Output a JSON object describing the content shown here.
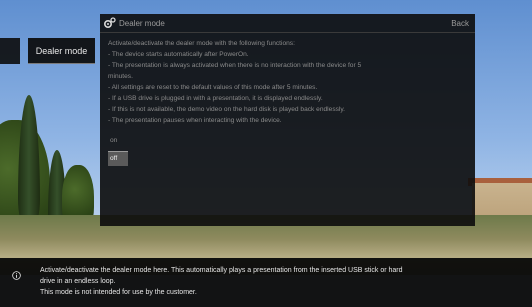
{
  "sidebar": {
    "selected_label": "Dealer mode"
  },
  "dialog": {
    "title": "Dealer mode",
    "back_label": "Back",
    "icon": "gear-icon",
    "description_lines": [
      "Activate/deactivate the dealer mode with the following functions:",
      "- The device starts automatically after PowerOn.",
      "- The presentation is always activated when there is no interaction with the device for 5",
      "minutes.",
      "- All settings are reset to the default values of this mode after 5 minutes.",
      "- If a USB drive is plugged in with a presentation, it is displayed endlessly.",
      "- If this is not available, the demo video on the hard disk is played back endlessly.",
      "- The presentation pauses when interacting with the device."
    ],
    "options": [
      "on",
      "off"
    ],
    "selected_option": "off"
  },
  "info_bar": {
    "icon": "info-icon",
    "lines": [
      "Activate/deactivate the dealer mode here. This automatically plays a presentation from the inserted USB stick or hard",
      "drive in an endless loop.",
      "This mode is not intended for use by the customer."
    ]
  },
  "colors": {
    "panel_bg": "#0c0c0c",
    "selected_option_bg": "#5a5a5a",
    "text_dim": "#8a8a8a",
    "text_bright": "#e6e6e6"
  }
}
